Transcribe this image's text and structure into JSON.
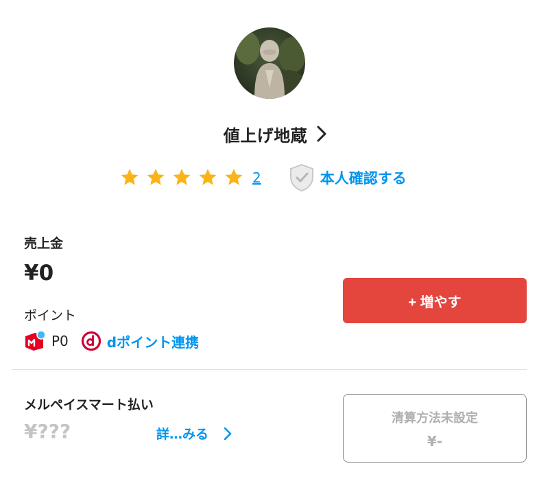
{
  "profile": {
    "username": "値上げ地蔵",
    "rating_stars": 5,
    "review_count": "2",
    "verify_label": "本人確認する"
  },
  "sales": {
    "label": "売上金",
    "value": "¥0",
    "increase_button": "+ 増やす"
  },
  "points": {
    "label": "ポイント",
    "merpoint_value": "P0",
    "dpoint_link": "dポイント連携"
  },
  "merpay_smart": {
    "label": "メルペイスマート払い",
    "amount": "¥???",
    "detail_link": "詳…みる",
    "settle_label": "清算方法未設定",
    "settle_amount": "¥-"
  },
  "colors": {
    "accent_red": "#e4453d",
    "link_blue": "#0095ee",
    "star": "#fbb417"
  },
  "icons": [
    "chevron-right-icon",
    "star-icon",
    "shield-check-icon",
    "merpay-icon",
    "dpoint-icon"
  ]
}
